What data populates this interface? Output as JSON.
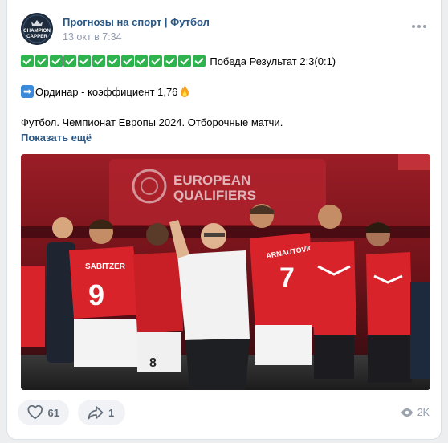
{
  "post": {
    "group_name": "Прогнозы на спорт | Футбол",
    "date": "13 окт в 7:34",
    "avatar_text_line1": "CHAMPION",
    "avatar_text_line2": "CAPPER",
    "check_count": 13,
    "result_text": "Победа Результат 2:3(0:1)",
    "arrow_glyph": "➡",
    "ordinar_text": "Ординар - коэффициент 1,76",
    "description": "Футбол. Чемпионат Европы 2024. Отборочные матчи.",
    "show_more": "Показать ещё"
  },
  "photo": {
    "banner_line1": "EUROPEAN",
    "banner_line2": "QUALIFIERS",
    "shirt_names": [
      "SABITZER",
      "ARNAUTOVIC"
    ],
    "shirt_numbers": [
      "9",
      "7",
      "8"
    ],
    "colors": {
      "kit": "#d8232a",
      "stadium": "#8a1a22",
      "coach_shirt": "#f2f2f2"
    }
  },
  "footer": {
    "likes": "61",
    "shares": "1",
    "views": "2K"
  },
  "colors": {
    "link": "#2a5885",
    "muted": "#939cb0",
    "check_green": "#2fb34f",
    "arrow_blue": "#3b8ad9"
  }
}
